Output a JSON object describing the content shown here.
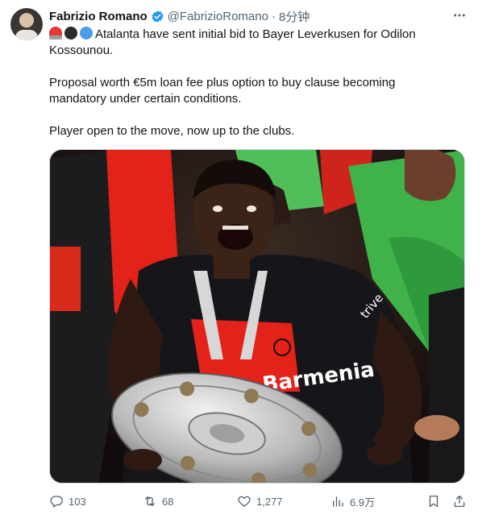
{
  "author": {
    "name": "Fabrizio Romano",
    "handle": "@FabrizioRomano",
    "separator": "·",
    "time": "8分钟"
  },
  "tweet": {
    "emoji": [
      "siren-emoji",
      "black-circle-emoji",
      "blue-circle-emoji"
    ],
    "lines": [
      "Atalanta have sent initial bid to Bayer Leverkusen for Odilon",
      "Kossounou.",
      "Proposal worth €5m loan fee plus option to buy clause becoming",
      "mandatory under certain conditions.",
      "Player open to the move, now up to the clubs."
    ]
  },
  "media": {
    "shirt_sponsor": "Barmenia",
    "sleeve_sponsor": "trive"
  },
  "actions": {
    "replies": "103",
    "reposts": "68",
    "likes": "1,277",
    "views": "6.9万"
  },
  "colors": {
    "verified": "#1d9bf0",
    "text": "#0f1419",
    "muted": "#536471",
    "leverkusen_red": "#e32219",
    "keeper_green": "#3fb24a"
  }
}
